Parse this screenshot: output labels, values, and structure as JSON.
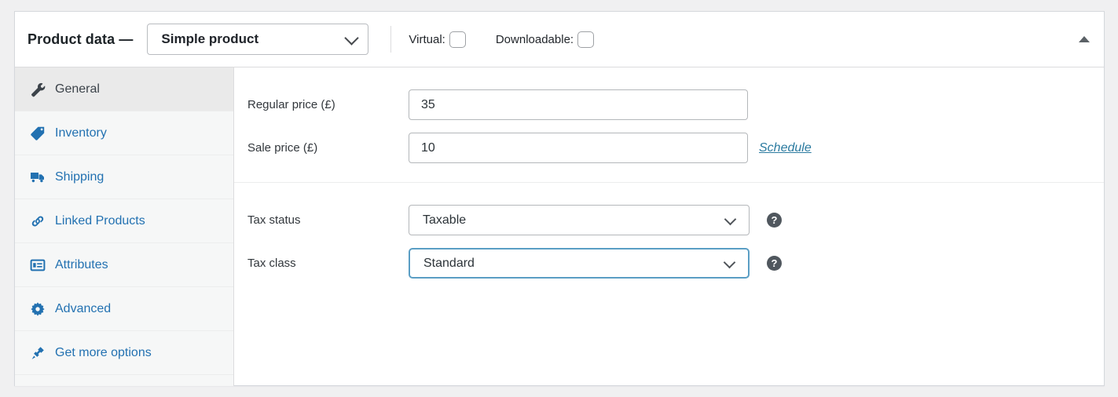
{
  "header": {
    "title": "Product data —",
    "product_type": "Simple product",
    "product_type_icon": "chevron-down-icon",
    "checkboxes": [
      {
        "label": "Virtual:",
        "checked": false,
        "name": "virtual"
      },
      {
        "label": "Downloadable:",
        "checked": false,
        "name": "downloadable"
      }
    ],
    "collapse_icon": "triangle-up-icon"
  },
  "tabs": [
    {
      "label": "General",
      "icon": "wrench-icon",
      "active": true
    },
    {
      "label": "Inventory",
      "icon": "tag-icon",
      "active": false
    },
    {
      "label": "Shipping",
      "icon": "truck-icon",
      "active": false
    },
    {
      "label": "Linked Products",
      "icon": "link-icon",
      "active": false
    },
    {
      "label": "Attributes",
      "icon": "list-details-icon",
      "active": false
    },
    {
      "label": "Advanced",
      "icon": "gear-icon",
      "active": false
    },
    {
      "label": "Get more options",
      "icon": "plug-icon",
      "active": false
    }
  ],
  "general": {
    "regular_price": {
      "label": "Regular price (£)",
      "value": "35",
      "placeholder": ""
    },
    "sale_price": {
      "label": "Sale price (£)",
      "value": "10",
      "placeholder": ""
    },
    "schedule_link": "Schedule",
    "tax_status": {
      "label": "Tax status",
      "value": "Taxable",
      "help_icon": "help-icon"
    },
    "tax_class": {
      "label": "Tax class",
      "value": "Standard",
      "help_icon": "help-icon",
      "focused": true
    }
  },
  "colors": {
    "accent_blue": "#2271b1",
    "focus_border": "#5a9ec4",
    "link": "#2c7ba0",
    "active_tab_bg": "#eaeaea",
    "sidebar_bg": "#f6f7f7",
    "page_bg": "#f0f0f1"
  }
}
